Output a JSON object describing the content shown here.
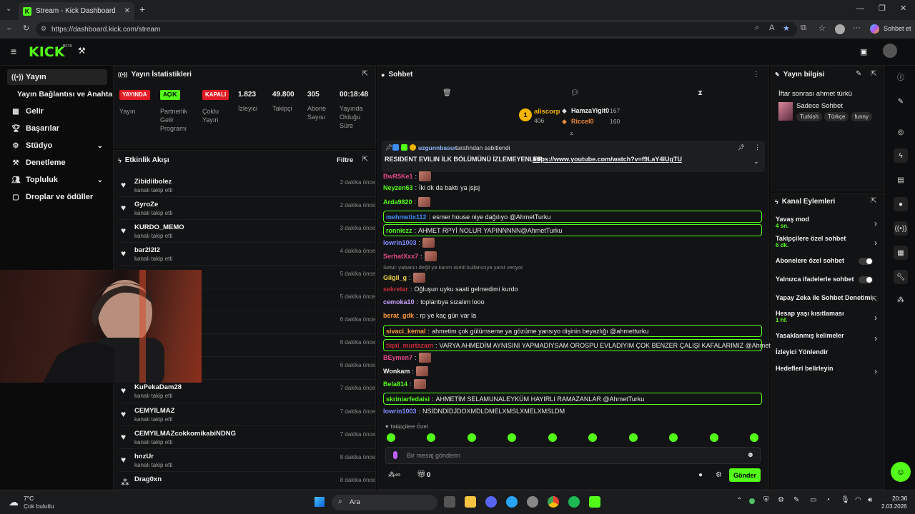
{
  "browser": {
    "tab_title": "Stream - Kick Dashboard",
    "url": "https://dashboard.kick.com/stream",
    "chat_button": "Sohbet et"
  },
  "kick": {
    "logo": "KICK",
    "beta": "BETA"
  },
  "sidebar": {
    "items": [
      {
        "label": "Yayın",
        "icon": "broadcast-icon"
      },
      {
        "label": "Yayın Bağlantısı ve Anahtarı",
        "icon": ""
      },
      {
        "label": "Gelir",
        "icon": "revenue-icon"
      },
      {
        "label": "Başarılar",
        "icon": "trophy-icon"
      },
      {
        "label": "Stüdyo",
        "icon": "studio-icon"
      },
      {
        "label": "Denetleme",
        "icon": "moderation-icon"
      },
      {
        "label": "Topluluk",
        "icon": "community-icon"
      },
      {
        "label": "Droplar ve ödüller",
        "icon": "drops-icon"
      }
    ]
  },
  "stats": {
    "title": "Yayın İstatistikleri",
    "items": [
      {
        "badge": "YAYINDA",
        "label": "Yayın"
      },
      {
        "badge": "AÇIK",
        "label": "Partnerlik Gelir Programı"
      },
      {
        "badge": "KAPALI",
        "label": "Çoklu Yayın"
      },
      {
        "value": "1.823",
        "label": "İzleyici"
      },
      {
        "value": "49.800",
        "label": "Takipçi"
      },
      {
        "value": "305",
        "label": "Abone Sayısı"
      },
      {
        "value": "00:18:48",
        "label": "Yayında Olduğu Süre"
      }
    ]
  },
  "activity": {
    "title": "Etkinlik Akışı",
    "filter": "Filtre",
    "rows": [
      {
        "name": "Zibidiibolez",
        "sub": "kanalı takip etti",
        "time": "2 dakika önce"
      },
      {
        "name": "GyroZe",
        "sub": "kanalı takip etti",
        "time": "2 dakika önce"
      },
      {
        "name": "KURDO_MEMO",
        "sub": "kanalı takip etti",
        "time": "3 dakika önce"
      },
      {
        "name": "bar2l2l2",
        "sub": "kanalı takip etti",
        "time": "4 dakika önce"
      },
      {
        "name": "",
        "sub": "",
        "time": "5 dakika önce"
      },
      {
        "name": "",
        "sub": "",
        "time": "5 dakika önce"
      },
      {
        "name": "",
        "sub": "",
        "time": "6 dakika önce"
      },
      {
        "name": "",
        "sub": "",
        "time": "6 dakika önce"
      },
      {
        "name": "",
        "sub": "",
        "time": "6 dakika önce"
      },
      {
        "name": "KuPekaDam28",
        "sub": "kanalı takip etti",
        "time": "7 dakika önce"
      },
      {
        "name": "CEMYILMAZ",
        "sub": "kanalı takip etti",
        "time": "7 dakika önce"
      },
      {
        "name": "CEMYILMAZcokkomikabiNDNG",
        "sub": "kanalı takip etti",
        "time": "7 dakika önce"
      },
      {
        "name": "hnzUr",
        "sub": "kanalı takip etti",
        "time": "8 dakika önce"
      },
      {
        "name": "Drag0xn",
        "sub": "",
        "time": "8 dakika önce"
      }
    ]
  },
  "chat": {
    "title": "Sohbet",
    "leaders": [
      {
        "name": "aliscorp",
        "count": "406",
        "rank": "1"
      },
      {
        "name": "HamzaYigit0",
        "count": "167"
      },
      {
        "name": "Riccel0",
        "count": "160"
      }
    ],
    "pinned": {
      "by": "uzgunnbasur",
      "by_suffix": "tarafından sabitlendi",
      "text": "RESIDENT EVILIN İLK BÖLÜMÜNÜ İZLEMEYENLER:",
      "link": "https://www.youtube.com/watch?v=f9LaY4lUgTU"
    },
    "messages": [
      {
        "user": "BwR5Ke1",
        "color": "#e34b8a",
        "text": "",
        "emote": true
      },
      {
        "user": "Neyzen63",
        "color": "#53fc18",
        "text": "İki dk da baktı ya jsjsj"
      },
      {
        "user": "Arda9820",
        "color": "#53fc18",
        "text": "",
        "emote": true
      },
      {
        "user": "mehmetix112",
        "color": "#3d8df0",
        "text": "esmer house niye dağılıyo @AhmetTurku",
        "hl": true
      },
      {
        "user": "ronniezz",
        "color": "#53fc18",
        "text": "AHMET RPYİ NOLUR YAPINNNNN@AhmetTurku",
        "hl": true
      },
      {
        "user": "lowrin1003",
        "color": "#7f8cff",
        "text": "",
        "emote": true
      },
      {
        "user": "SerhatXxx7",
        "color": "#e34b8a",
        "text": "",
        "emote": true
      },
      {
        "reply": "Setul: yabancı değil ya karım isimil kullanıcıya yanıt veriyor"
      },
      {
        "user": "Gilgil_g",
        "color": "#f0d34a",
        "text": "",
        "emote": true
      },
      {
        "user": "sekretar",
        "color": "#c22b3a",
        "text": "Oğluşun uyku saati gelmedimi kurdo"
      },
      {
        "user": "cemoka10",
        "color": "#c9a2ff",
        "text": "toplantıya sızalım looo"
      },
      {
        "user": "berat_gdk",
        "color": "#ff9a3c",
        "text": "rp ye kaç gün var la"
      },
      {
        "user": "sivaci_kemal",
        "color": "#ff9a3c",
        "text": "ahmetim çok gülümseme ya gözüme yansıyo dişinin beyazlığı @ahmetturku",
        "hl": true
      },
      {
        "user": "tiqai_murtazam",
        "color": "#c22b3a",
        "text": "VARYA AHMEDİM AYNISINI YAPMADIYSAM OROSPU EVLADIYIM ÇOK BENZER ÇALIŞI KAFALARIMIZ @AhmetTurku",
        "hl": true
      },
      {
        "user": "BEymen7",
        "color": "#e34b8a",
        "text": "",
        "emote": true
      },
      {
        "user": "Wonkam",
        "color": "#f0f0f0",
        "text": "",
        "emote": true
      },
      {
        "user": "Bela814",
        "color": "#53fc18",
        "text": "",
        "emote": true
      },
      {
        "user": "skriniarfedaisi",
        "color": "#53fc18",
        "text": "AHMETİM SELAMUNALEYKÜM HAYIRLI RAMAZANLAR @AhmetTurku",
        "hl": true
      },
      {
        "user": "lowrin1003",
        "color": "#7f8cff",
        "text": "NSİDNDİDJDOXMDLDMELXMSLXMELXMSLDM"
      }
    ],
    "follower_label": "Takipçilere Özel",
    "input_placeholder": "Bir mesaj gönderin",
    "points": "0",
    "send": "Gönder"
  },
  "stream_info": {
    "title": "Yayın bilgisi",
    "stream_title": "İftar sonrası ahmet türkü",
    "category": "Sadece Sohbet",
    "tags": [
      "Turkish",
      "Türkçe",
      "funny"
    ]
  },
  "channel_actions": {
    "title": "Kanal Eylemleri",
    "items": [
      {
        "label": "Yavaş mod",
        "sub": "4 sn.",
        "control": "chevron"
      },
      {
        "label": "Takipçilere özel sohbet",
        "sub": "6 dk.",
        "control": "chevron"
      },
      {
        "label": "Abonelere özel sohbet",
        "sub": "",
        "control": "toggle"
      },
      {
        "label": "Yalnızca ifadelerle sohbet",
        "sub": "",
        "control": "toggle"
      },
      {
        "label": "Yapay Zeka ile Sohbet Denetimi",
        "sub": "",
        "control": "external"
      },
      {
        "label": "Hesap yaşı kısıtlaması",
        "sub": "1 hf.",
        "control": "chevron"
      },
      {
        "label": "Yasaklanmış kelimeler",
        "sub": "",
        "control": "chevron"
      },
      {
        "label": "İzleyici Yönlendir",
        "sub": "",
        "control": "none"
      },
      {
        "label": "Hedefleri belirleyin",
        "sub": "",
        "control": "chevron"
      }
    ]
  },
  "taskbar": {
    "weather_temp": "7°C",
    "weather_desc": "Çok bulutlu",
    "search": "Ara",
    "time": "20:36",
    "date": "2.03.2026"
  },
  "colors": {
    "accent": "#53fc18",
    "red": "#e01b24",
    "bg": "#0b0b0b"
  }
}
